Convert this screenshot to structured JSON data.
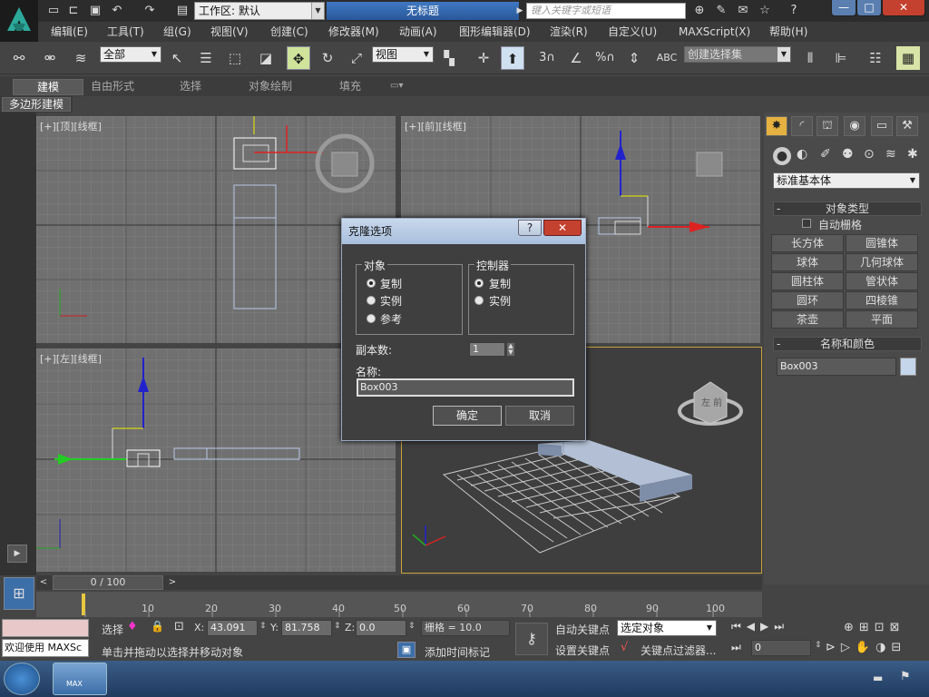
{
  "titlebar": {
    "workspace_label": "工作区: 默认",
    "app_title": "无标题",
    "search_placeholder": "键入关键字或短语",
    "minimize": "—",
    "maximize": "□",
    "close": "✕"
  },
  "menu": [
    "编辑(E)",
    "工具(T)",
    "组(G)",
    "视图(V)",
    "创建(C)",
    "修改器(M)",
    "动画(A)",
    "图形编辑器(D)",
    "渲染(R)",
    "自定义(U)",
    "MAXScript(X)",
    "帮助(H)"
  ],
  "toolbar": {
    "filter": "全部",
    "ref_coord": "视图",
    "named_selection": "创建选择集",
    "snap_3": "3",
    "snap_pct": "%"
  },
  "ribbon": {
    "tabs": [
      "建模",
      "自由形式",
      "选择",
      "对象绘制",
      "填充"
    ],
    "subtab": "多边形建模"
  },
  "viewports": {
    "top": "[+][顶][线框]",
    "front": "[+][前][线框]",
    "left": "[+][左][线框]",
    "persp_cube_label": "左  前"
  },
  "command_panel": {
    "category": "标准基本体",
    "object_type_title": "对象类型",
    "autogrid": "自动栅格",
    "buttons": [
      "长方体",
      "圆锥体",
      "球体",
      "几何球体",
      "圆柱体",
      "管状体",
      "圆环",
      "四棱锥",
      "茶壶",
      "平面"
    ],
    "name_color_title": "名称和颜色",
    "object_name": "Box003",
    "object_color": "#c5d5ea"
  },
  "dialog": {
    "title": "克隆选项",
    "help": "?",
    "close": "✕",
    "object_group": "对象",
    "object_options": [
      "复制",
      "实例",
      "参考"
    ],
    "controller_group": "控制器",
    "controller_options": [
      "复制",
      "实例"
    ],
    "copies_label": "副本数:",
    "copies_value": "1",
    "name_label": "名称:",
    "name_value": "Box003",
    "ok": "确定",
    "cancel": "取消"
  },
  "timeline": {
    "frame": "0 / 100",
    "ticks": [
      "10",
      "20",
      "30",
      "40",
      "50",
      "60",
      "70",
      "80",
      "90",
      "100"
    ]
  },
  "status": {
    "maxscript": "欢迎使用 MAXSc",
    "sel_label": "选择",
    "x_label": "X:",
    "x_value": "43.091",
    "y_label": "Y:",
    "y_value": "81.758",
    "z_label": "Z:",
    "z_value": "0.0",
    "grid": "栅格 = 10.0",
    "prompt": "单击并拖动以选择并移动对象",
    "add_time_tag": "添加时间标记",
    "auto_key": "自动关键点",
    "set_key": "设置关键点",
    "selected_object": "选定对象",
    "key_filters": "关键点过滤器...",
    "frame_value": "0"
  },
  "taskbar": {
    "app_label": "MAX",
    "lang": "▬"
  }
}
